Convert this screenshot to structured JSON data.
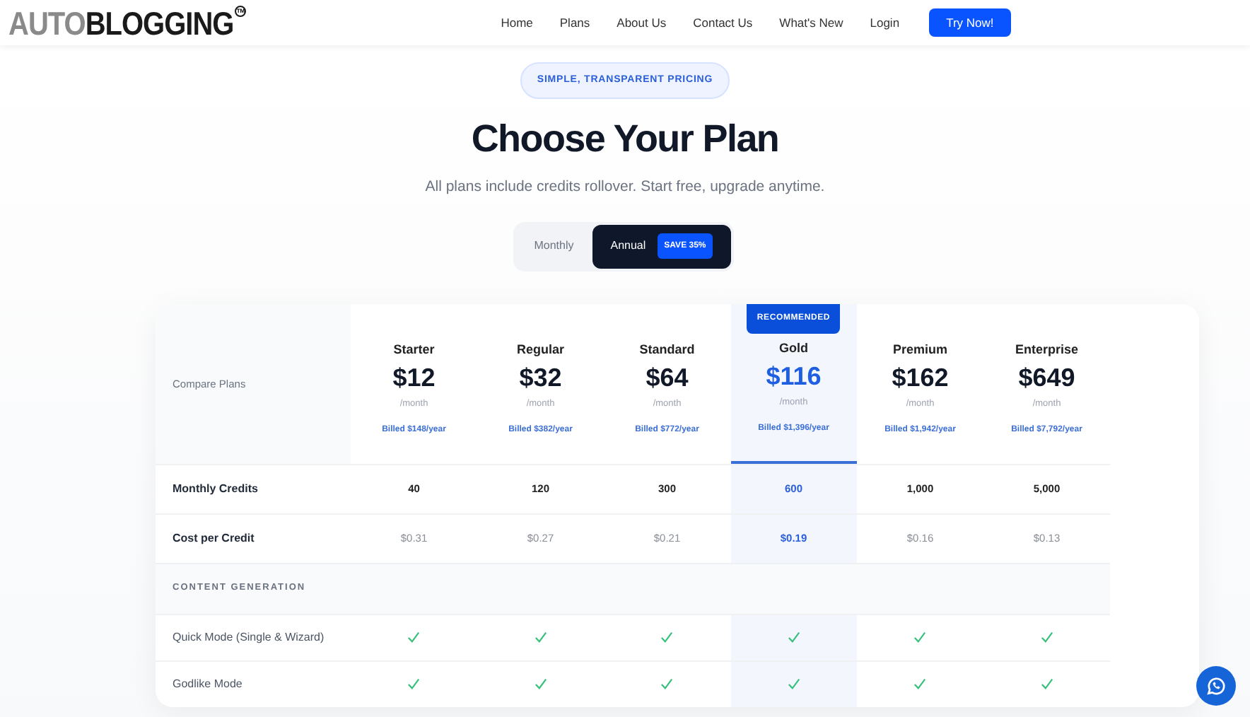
{
  "header": {
    "logo": {
      "light": "AUTO",
      "bold": "BLOGGING",
      "mark": "TM"
    },
    "nav": [
      "Home",
      "Plans",
      "About Us",
      "Contact Us",
      "What's New",
      "Login"
    ],
    "cta": "Try Now!"
  },
  "hero": {
    "badge": "SIMPLE, TRANSPARENT PRICING",
    "title": "Choose Your Plan",
    "subtitle": "All plans include credits rollover. Start free, upgrade anytime."
  },
  "billing_toggle": [
    {
      "label": "Monthly",
      "selected": false
    },
    {
      "label": "Annual",
      "selected": true,
      "badge": "SAVE 35%"
    }
  ],
  "table": {
    "corner": "Compare Plans",
    "recommended_badge": "RECOMMENDED",
    "plans": [
      {
        "name": "Starter",
        "price": "$12",
        "period": "/month",
        "billed": "Billed $148/year",
        "recommended": false
      },
      {
        "name": "Regular",
        "price": "$32",
        "period": "/month",
        "billed": "Billed $382/year",
        "recommended": false
      },
      {
        "name": "Standard",
        "price": "$64",
        "period": "/month",
        "billed": "Billed $772/year",
        "recommended": false
      },
      {
        "name": "Gold",
        "price": "$116",
        "period": "/month",
        "billed": "Billed $1,396/year",
        "recommended": true
      },
      {
        "name": "Premium",
        "price": "$162",
        "period": "/month",
        "billed": "Billed $1,942/year",
        "recommended": false
      },
      {
        "name": "Enterprise",
        "price": "$649",
        "period": "/month",
        "billed": "Billed $7,792/year",
        "recommended": false
      }
    ],
    "rows": [
      {
        "kind": "credits",
        "label": "Monthly Credits",
        "values": [
          "40",
          "120",
          "300",
          "600",
          "1,000",
          "5,000"
        ]
      },
      {
        "kind": "cost",
        "label": "Cost per Credit",
        "values": [
          "$0.31",
          "$0.27",
          "$0.21",
          "$0.19",
          "$0.16",
          "$0.13"
        ]
      },
      {
        "kind": "section",
        "label": "CONTENT GENERATION"
      },
      {
        "kind": "check",
        "label": "Quick Mode (Single & Wizard)",
        "checks": [
          true,
          true,
          true,
          true,
          true,
          true
        ]
      },
      {
        "kind": "check",
        "label": "Godlike Mode",
        "checks": [
          true,
          true,
          true,
          true,
          true,
          true
        ]
      }
    ]
  }
}
